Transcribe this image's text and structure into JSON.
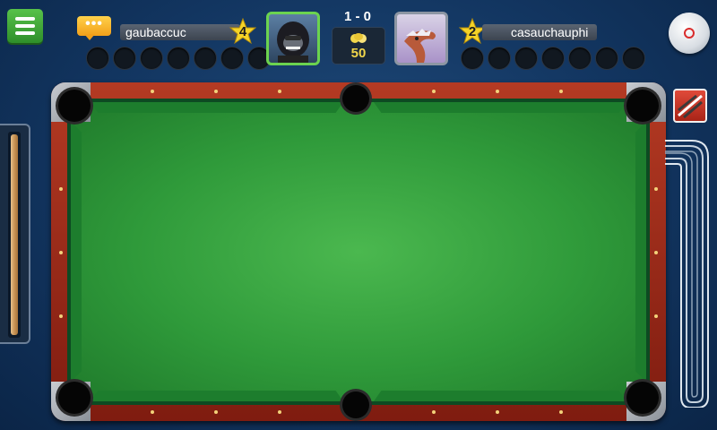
{
  "header": {
    "player1": {
      "name": "gaubaccuc",
      "level": "4"
    },
    "player2": {
      "name": "casauchauphi",
      "level": "2"
    },
    "score": "1 - 0",
    "pot_amount": "50"
  },
  "chat": {
    "dots": "•••"
  },
  "colors": {
    "felt": "#3fae46",
    "rail": "#9b2a18",
    "background": "#143a66",
    "accent_green": "#4fbf45",
    "coin": "#f1d64b"
  },
  "icons": [
    "menu-icon",
    "chat-icon",
    "star-icon",
    "coins-icon",
    "settings-icon",
    "cue-icon"
  ]
}
